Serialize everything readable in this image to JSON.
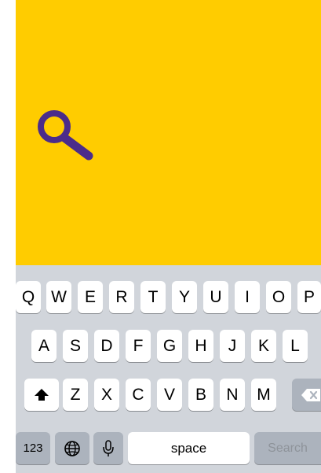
{
  "colors": {
    "accent": "#ffcc00",
    "icon": "#4b2c8a",
    "keyboard_bg": "#d1d5db",
    "key": "#ffffff",
    "key_dark": "#acb3bd"
  },
  "search": {
    "icon": "magnifying-glass-icon"
  },
  "keyboard": {
    "row1": [
      "Q",
      "W",
      "E",
      "R",
      "T",
      "Y",
      "U",
      "I",
      "O",
      "P"
    ],
    "row2": [
      "A",
      "S",
      "D",
      "F",
      "G",
      "H",
      "J",
      "K",
      "L"
    ],
    "row3": [
      "Z",
      "X",
      "C",
      "V",
      "B",
      "N",
      "M"
    ],
    "shift_icon": "shift-arrow-icon",
    "delete_icon": "backspace-icon",
    "numbers_label": "123",
    "globe_icon": "globe-icon",
    "mic_icon": "microphone-icon",
    "space_label": "space",
    "return_label": "Search"
  }
}
